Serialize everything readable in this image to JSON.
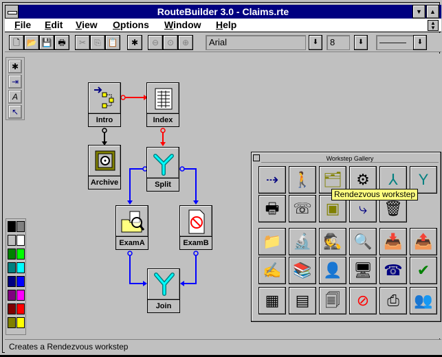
{
  "window": {
    "title": "RouteBuilder 3.0 - Claims.rte"
  },
  "menu": [
    "File",
    "Edit",
    "View",
    "Options",
    "Window",
    "Help"
  ],
  "toolbar": {
    "font_name": "Arial",
    "font_size": "8"
  },
  "canvas": {
    "nodes": [
      {
        "id": "intro",
        "label": "Intro"
      },
      {
        "id": "index",
        "label": "Index"
      },
      {
        "id": "archive",
        "label": "Archive"
      },
      {
        "id": "split",
        "label": "Split"
      },
      {
        "id": "examA",
        "label": "ExamA"
      },
      {
        "id": "examB",
        "label": "ExamB"
      },
      {
        "id": "join",
        "label": "Join"
      }
    ],
    "link_colors": {
      "red": "#ff0000",
      "blue": "#0000ff",
      "black": "#000000"
    }
  },
  "gallery": {
    "title": "Workstep Gallery",
    "tooltip": "Rendezvous workstep",
    "rows": [
      [
        "route-flow-icon",
        "person-walking-icon",
        "folder-clock-icon",
        "gears-icon",
        "split-icon",
        "join-icon"
      ],
      [
        "printer-icon",
        "fax-icon",
        "safe-icon",
        "document-arrow-icon",
        "trash-icon"
      ],
      [
        "folder-icon",
        "microscope-icon",
        "detective-icon",
        "folder-search-icon",
        "inbox-icon",
        "outbox-icon"
      ],
      [
        "document-hand-icon",
        "books-icon",
        "person-desk-icon",
        "computer-icon",
        "telephone-icon",
        "checkmark-x-icon"
      ],
      [
        "index-grid-icon",
        "pages-icon",
        "scattered-papers-icon",
        "no-document-icon",
        "scanner-icon",
        "people-icon"
      ]
    ]
  },
  "palette_colors": [
    "#000000",
    "#808080",
    "#c0c0c0",
    "#ffffff",
    "#008000",
    "#00ff00",
    "#008080",
    "#00ffff",
    "#000080",
    "#0000ff",
    "#800080",
    "#ff00ff",
    "#800000",
    "#ff0000",
    "#808000",
    "#ffff00"
  ],
  "status": "Creates a Rendezvous workstep"
}
